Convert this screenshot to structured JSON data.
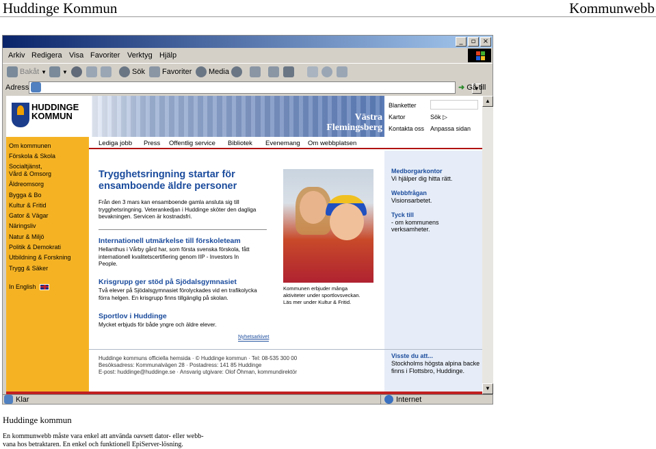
{
  "doc": {
    "header_left": "Huddinge Kommun",
    "header_right": "Kommunwebb",
    "caption_title": "Huddinge kommun",
    "caption_body_1": "En kommunwebb måste vara enkel att använda oavsett dator- eller webb-",
    "caption_body_2": "vana hos betraktaren. En enkel och funktionell EpiServer-lösning."
  },
  "browser": {
    "menu": [
      "Arkiv",
      "Redigera",
      "Visa",
      "Favoriter",
      "Verktyg",
      "Hjälp"
    ],
    "toolbar": {
      "back": "Bakåt",
      "search": "Sök",
      "favorites": "Favoriter",
      "media": "Media"
    },
    "address_label": "Adress",
    "address_value": "",
    "go_label": "Gå till",
    "status_left": "Klar",
    "status_zone": "Internet"
  },
  "site": {
    "logo_line1": "HUDDINGE",
    "logo_line2": "KOMMUN",
    "header_title_1": "Västra",
    "header_title_2": "Flemingsberg",
    "header_links": {
      "blanketter": "Blanketter",
      "kartor": "Kartor",
      "sok": "Sök",
      "kontakta": "Kontakta oss",
      "anpassa": "Anpassa sidan"
    },
    "leftnav": [
      "Om kommunen",
      "Förskola & Skola",
      "Socialtjänst,",
      "Vård & Omsorg",
      "Äldreomsorg",
      "Bygga & Bo",
      "Kultur & Fritid",
      "Gator & Vägar",
      "Näringsliv",
      "Natur & Miljö",
      "Politik & Demokrati",
      "Utbildning & Forskning",
      "Trygg & Säker"
    ],
    "in_english": "In English",
    "topnav": [
      "Lediga jobb",
      "Press",
      "Offentlig service",
      "Bibliotek",
      "Evenemang",
      "Om webbplatsen"
    ],
    "main": {
      "headline_1": "Trygghetsringning startar för",
      "headline_2": "ensamboende äldre personer",
      "lead_1": "Från den 3 mars kan ensamboende gamla ansluta sig till",
      "lead_2": "trygghetsringning. Veterankedjan i Huddinge sköter den dagliga",
      "lead_3": "bevakningen. Servicen är kostnadsfri.",
      "news": [
        {
          "title": "Internationell utmärkelse till förskoleteam",
          "lines": [
            "Hellanthus i Vårby gård har, som första svenska förskola, fått",
            "internationell kvalitetscertifiering genom IIP - Investors In",
            "People."
          ]
        },
        {
          "title": "Krisgrupp ger stöd på Sjödalsgymnasiet",
          "lines": [
            "Två elever på Sjödalsgymnasiet förolyckades vid en trafikolycka",
            "förra helgen. En krisgrupp finns tillgänglig på skolan."
          ]
        },
        {
          "title": "Sportlov i Huddinge",
          "lines": [
            "Mycket erbjuds för både yngre och äldre elever."
          ]
        }
      ],
      "archive_link": "Nyhetsarkivet",
      "photo_caption": [
        "Kommunen erbjuder många",
        "aktiviteter under sportlovsveckan.",
        "Läs mer under Kultur & Fritid."
      ]
    },
    "right": [
      {
        "title": "Medborgarkontor",
        "lines": [
          "Vi hjälper dig hitta rätt."
        ]
      },
      {
        "title": "Webbfrågan",
        "lines": [
          "Visionsarbetet."
        ]
      },
      {
        "title": "Tyck till",
        "lines": [
          "- om kommunens",
          "verksamheter."
        ]
      }
    ],
    "footer": [
      "Huddinge kommuns officiella hemsida · © Huddinge kommun · Tel: 08-535 300 00",
      "Besöksadress: Kommunalvägen 28 · Postadress: 141 85 Huddinge",
      "E-post: huddinge@huddinge.se · Ansvarig utgivare: Olof Öhman, kommundirektör"
    ],
    "visste": {
      "title": "Visste du att...",
      "lines": [
        "Stockholms högsta alpina backe",
        "finns i Flottsbro, Huddinge."
      ]
    }
  }
}
